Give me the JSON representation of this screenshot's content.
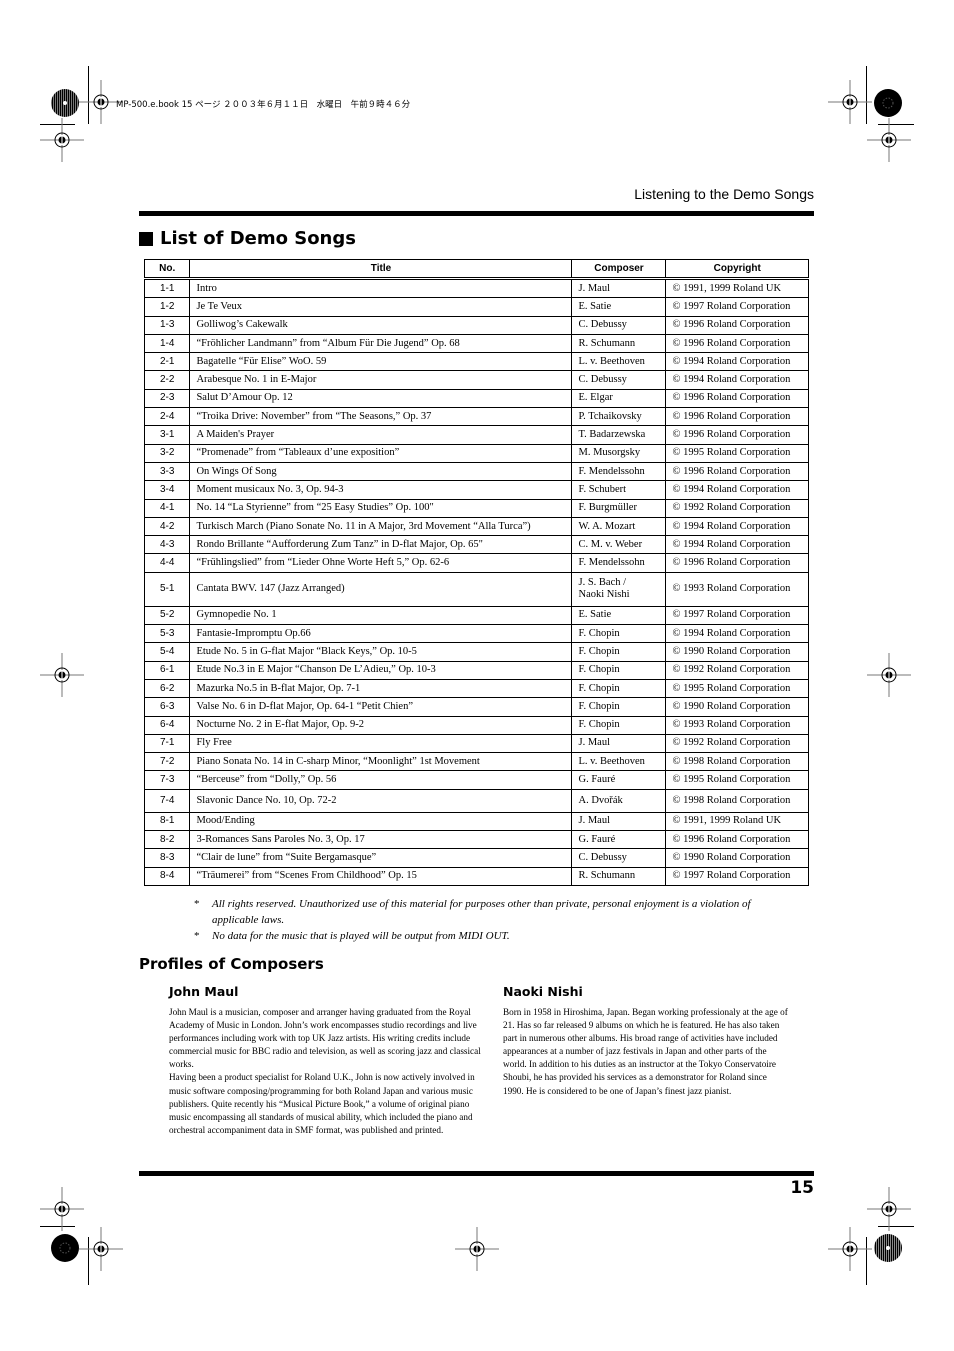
{
  "print_header": "MP-500.e.book  15 ページ  ２００３年６月１１日　水曜日　午前９時４６分",
  "running_head": "Listening to the Demo Songs",
  "section_title": "List of Demo Songs",
  "table": {
    "headers": [
      "No.",
      "Title",
      "Composer",
      "Copyright"
    ],
    "rows": [
      {
        "no": "1-1",
        "title": "Intro",
        "composer": "J. Maul",
        "copyright": "© 1991, 1999 Roland UK"
      },
      {
        "no": "1-2",
        "title": "Je Te Veux",
        "composer": "E. Satie",
        "copyright": "© 1997 Roland Corporation"
      },
      {
        "no": "1-3",
        "title": "Golliwog’s Cakewalk",
        "composer": "C. Debussy",
        "copyright": "© 1996 Roland Corporation"
      },
      {
        "no": "1-4",
        "title": "“Fröhlicher Landmann” from “Album Für Die Jugend” Op. 68",
        "composer": "R. Schumann",
        "copyright": "© 1996 Roland Corporation"
      },
      {
        "no": "2-1",
        "title": "Bagatelle “Für Elise” WoO. 59",
        "composer": "L. v. Beethoven",
        "copyright": "© 1994 Roland Corporation"
      },
      {
        "no": "2-2",
        "title": "Arabesque No. 1 in E-Major",
        "composer": "C. Debussy",
        "copyright": "© 1994 Roland Corporation"
      },
      {
        "no": "2-3",
        "title": "Salut D’Amour Op. 12",
        "composer": "E. Elgar",
        "copyright": "© 1996 Roland Corporation"
      },
      {
        "no": "2-4",
        "title": "“Troika Drive: November” from “The Seasons,” Op. 37",
        "composer": "P. Tchaikovsky",
        "copyright": "© 1996 Roland Corporation"
      },
      {
        "no": "3-1",
        "title": "A Maiden's Prayer",
        "composer": "T. Badarzewska",
        "copyright": "© 1996 Roland Corporation"
      },
      {
        "no": "3-2",
        "title": "“Promenade” from “Tableaux d’une exposition”",
        "composer": "M. Musorgsky",
        "copyright": "© 1995 Roland Corporation"
      },
      {
        "no": "3-3",
        "title": "On Wings Of Song",
        "composer": "F. Mendelssohn",
        "copyright": "© 1996 Roland Corporation"
      },
      {
        "no": "3-4",
        "title": "Moment musicaux No. 3, Op. 94-3",
        "composer": "F. Schubert",
        "copyright": "© 1994 Roland Corporation"
      },
      {
        "no": "4-1",
        "title": "No. 14 “La Styrienne” from “25 Easy Studies” Op. 100\"",
        "composer": "F. Burgmüller",
        "copyright": "© 1992 Roland Corporation"
      },
      {
        "no": "4-2",
        "title": "Turkisch March (Piano Sonate No. 11 in A Major, 3rd Movement “Alla Turca”)",
        "composer": "W. A. Mozart",
        "copyright": "© 1994 Roland Corporation"
      },
      {
        "no": "4-3",
        "title": "Rondo Brillante “Aufforderung Zum Tanz” in D-flat Major, Op. 65\"",
        "composer": "C. M. v. Weber",
        "copyright": "© 1994 Roland Corporation"
      },
      {
        "no": "4-4",
        "title": "“Frühlingslied” from “Lieder Ohne Worte Heft 5,” Op. 62-6",
        "composer": "F. Mendelssohn",
        "copyright": "© 1996 Roland Corporation"
      },
      {
        "no": "5-1",
        "title": "Cantata BWV. 147 (Jazz Arranged)",
        "composer": "J. S. Bach / Naoki Nishi",
        "copyright": "© 1993 Roland Corporation"
      },
      {
        "no": "5-2",
        "title": "Gymnopedie No. 1",
        "composer": "E. Satie",
        "copyright": "© 1997 Roland Corporation"
      },
      {
        "no": "5-3",
        "title": "Fantasie-Impromptu Op.66",
        "composer": "F. Chopin",
        "copyright": "© 1994 Roland Corporation"
      },
      {
        "no": "5-4",
        "title": "Etude No. 5 in G-flat Major “Black Keys,” Op. 10-5",
        "composer": "F. Chopin",
        "copyright": "© 1990 Roland Corporation"
      },
      {
        "no": "6-1",
        "title": "Etude No.3 in E Major “Chanson De L’Adieu,” Op. 10-3",
        "composer": "F. Chopin",
        "copyright": "© 1992 Roland Corporation"
      },
      {
        "no": "6-2",
        "title": "Mazurka No.5 in B-flat Major, Op. 7-1",
        "composer": "F. Chopin",
        "copyright": "© 1995 Roland Corporation"
      },
      {
        "no": "6-3",
        "title": "Valse No. 6 in D-flat Major, Op. 64-1 “Petit Chien”",
        "composer": "F. Chopin",
        "copyright": "© 1990 Roland Corporation"
      },
      {
        "no": "6-4",
        "title": "Nocturne No. 2 in E-flat Major, Op. 9-2",
        "composer": "F. Chopin",
        "copyright": "© 1993 Roland Corporation"
      },
      {
        "no": "7-1",
        "title": "Fly Free",
        "composer": "J. Maul",
        "copyright": "© 1992 Roland Corporation"
      },
      {
        "no": "7-2",
        "title": "Piano Sonata No. 14 in C-sharp Minor, “Moonlight” 1st Movement",
        "composer": "L. v. Beethoven",
        "copyright": "© 1998 Roland Corporation"
      },
      {
        "no": "7-3",
        "title": "“Berceuse” from “Dolly,” Op. 56",
        "composer": "G. Fauré",
        "copyright": "© 1995 Roland Corporation"
      },
      {
        "no": "7-4",
        "title": "Slavonic Dance No. 10, Op. 72-2",
        "composer": "A. Dvořák",
        "copyright": "© 1998 Roland Corporation"
      },
      {
        "no": "8-1",
        "title": "Mood/Ending",
        "composer": "J. Maul",
        "copyright": "© 1991, 1999 Roland UK"
      },
      {
        "no": "8-2",
        "title": "3-Romances Sans Paroles No. 3, Op. 17",
        "composer": "G. Fauré",
        "copyright": "© 1996 Roland Corporation"
      },
      {
        "no": "8-3",
        "title": "“Clair de lune” from “Suite Bergamasque”",
        "composer": "C. Debussy",
        "copyright": "© 1990 Roland Corporation"
      },
      {
        "no": "8-4",
        "title": "“Träumerei” from “Scenes From Childhood” Op. 15",
        "composer": "R. Schumann",
        "copyright": "© 1997 Roland Corporation"
      }
    ]
  },
  "notes": [
    {
      "mark": "*",
      "text": "All rights reserved. Unauthorized use of this material for purposes other than private, personal enjoyment is a violation of applicable laws."
    },
    {
      "mark": "*",
      "text": "No data for the music that is played will be output from MIDI OUT."
    }
  ],
  "profiles": {
    "title": "Profiles of Composers",
    "composers": [
      {
        "name": "John Maul",
        "bio": "John Maul is a musician, composer and arranger having graduated from the Royal Academy of Music in London. John’s work encompasses studio recordings and live performances including work with top UK Jazz artists. His writing credits include commercial music for BBC radio and television, as well as scoring jazz and classical works.",
        "bio2": "Having been a product specialist for Roland U.K., John is now actively involved in music software composing/programming for both Roland Japan and various music publishers. Quite recently his “Musical Picture Book,” a volume of original piano music encompassing all standards of musical ability, which included the piano and orchestral accompaniment data in SMF format, was published and printed."
      },
      {
        "name": "Naoki Nishi",
        "bio": "Born in 1958 in Hiroshima, Japan. Began working professionaly at the age of 21. Has so far released 9 albums on which he is featured. He has also taken part in numerous other albums. His broad range of activities have included appearances at a number of jazz festivals in Japan and other parts of the world. In addition to his duties as an instructor at the Tokyo Conservatoire Shoubi, he has provided his services as a demonstrator for Roland since 1990. He is considered to be one of Japan’s finest jazz pianist."
      }
    ]
  },
  "page_number": "15"
}
